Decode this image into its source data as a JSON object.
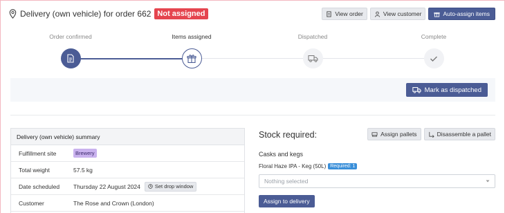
{
  "header": {
    "title": "Delivery (own vehicle) for order 662",
    "status_badge": "Not assigned",
    "buttons": {
      "view_order": "View order",
      "view_customer": "View customer",
      "auto_assign": "Auto-assign items"
    }
  },
  "steps": [
    {
      "label": "Order confirmed",
      "state": "done",
      "icon": "document-icon"
    },
    {
      "label": "Items assigned",
      "state": "current",
      "icon": "gift-box-icon"
    },
    {
      "label": "Dispatched",
      "state": "todo",
      "icon": "truck-icon"
    },
    {
      "label": "Complete",
      "state": "todo",
      "icon": "check-icon"
    }
  ],
  "dispatch": {
    "button": "Mark as dispatched"
  },
  "summary": {
    "title": "Delivery (own vehicle) summary",
    "fulfillment_label": "Fulfillment site",
    "fulfillment_value": "Brewery",
    "weight_label": "Total weight",
    "weight_value": "57.5 kg",
    "date_label": "Date scheduled",
    "date_value": "Thursday 22 August 2024",
    "drop_window_button": "Set drop window",
    "customer_label": "Customer",
    "customer_value": "The Rose and Crown (London)"
  },
  "stock": {
    "title": "Stock required:",
    "assign_pallets": "Assign pallets",
    "disassemble_pallet": "Disassemble a pallet",
    "category": "Casks and kegs",
    "item_name": "Floral Haze IPA - Keg (50L)",
    "item_required": "Required: 1",
    "select_placeholder": "Nothing selected",
    "assign_button": "Assign to delivery"
  },
  "colors": {
    "primary": "#4b5c95",
    "danger": "#e5454f",
    "brewery_tag": "#c9b2ee",
    "required_badge": "#3a8fd9"
  }
}
